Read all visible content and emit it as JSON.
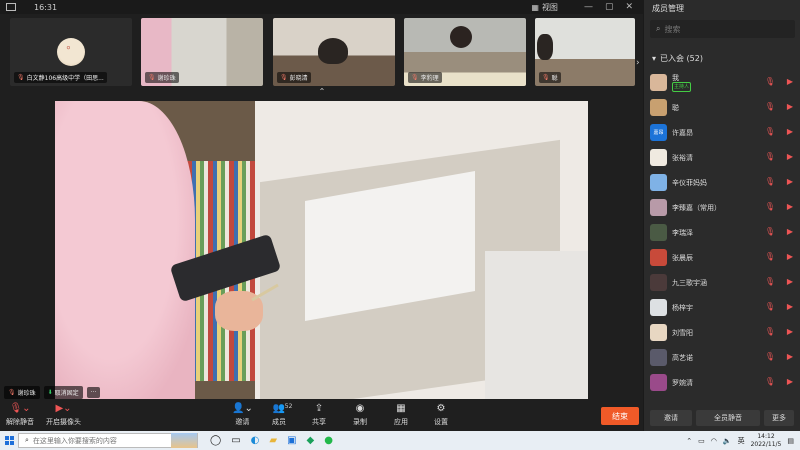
{
  "topbar": {
    "time": "16:31",
    "view_label": "视图",
    "minimize": "—",
    "maximize": "▢",
    "close": "✕"
  },
  "thumbnails": [
    {
      "name": "白文静106高级中学（田思..."
    },
    {
      "name": "谢珍珠"
    },
    {
      "name": "彭晓清"
    },
    {
      "name": "李豹理"
    },
    {
      "name": "聪"
    }
  ],
  "main_video": {
    "speaker_name": "谢珍珠",
    "unpin_label": "取消固定",
    "more": "···"
  },
  "toolbar": {
    "unmute": "解除静音",
    "start_video": "开启摄像头",
    "invite": "邀请",
    "members": "成员",
    "member_count": "52",
    "share": "共享",
    "record": "录制",
    "apps": "应用",
    "settings": "设置",
    "end": "结束"
  },
  "panel": {
    "title": "成员管理",
    "search_placeholder": "搜索",
    "group_label": "已入会 (52)",
    "members": [
      {
        "name": "我",
        "tag": "主持人",
        "color": "#d9b79a",
        "avatar_text": ""
      },
      {
        "name": "聪",
        "tag": "",
        "color": "#c8a070",
        "avatar_text": ""
      },
      {
        "name": "许嘉昂",
        "tag": "",
        "color": "#1c73d8",
        "avatar_text": "嘉昂"
      },
      {
        "name": "张裕清",
        "tag": "",
        "color": "#f0eae0",
        "avatar_text": ""
      },
      {
        "name": "辛仪菲妈妈",
        "tag": "",
        "color": "#7fb2e6",
        "avatar_text": ""
      },
      {
        "name": "李臻嘉（常用）",
        "tag": "",
        "color": "#b89aa8",
        "avatar_text": ""
      },
      {
        "name": "李瑞泽",
        "tag": "",
        "color": "#4a5a44",
        "avatar_text": ""
      },
      {
        "name": "张晨辰",
        "tag": "",
        "color": "#c84a3a",
        "avatar_text": ""
      },
      {
        "name": "九三歌宇涵",
        "tag": "",
        "color": "#4b3a3a",
        "avatar_text": ""
      },
      {
        "name": "杨梓宇",
        "tag": "",
        "color": "#dde0e3",
        "avatar_text": ""
      },
      {
        "name": "刘雪阳",
        "tag": "",
        "color": "#e8d7c2",
        "avatar_text": ""
      },
      {
        "name": "高艺诺",
        "tag": "",
        "color": "#5a5a6a",
        "avatar_text": ""
      },
      {
        "name": "罗婉清",
        "tag": "",
        "color": "#9a4a8a",
        "avatar_text": ""
      }
    ],
    "invite_btn": "邀请",
    "mute_all_btn": "全员静音",
    "more_btn": "更多"
  },
  "taskbar": {
    "search_placeholder": "在这里输入你要搜索的内容",
    "ime": "英",
    "time": "14:12",
    "date": "2022/11/5"
  }
}
